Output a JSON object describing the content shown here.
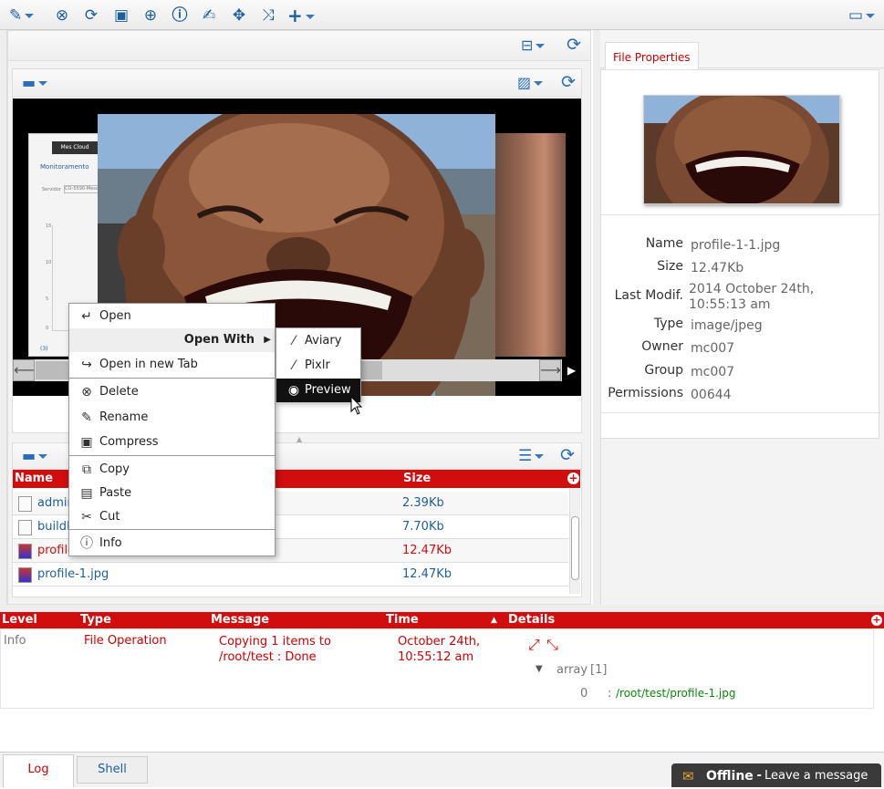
{
  "toolbar": {
    "icons": [
      "edit-icon",
      "cancel-icon",
      "refresh-icon",
      "toolbox-icon",
      "download-icon",
      "info-icon",
      "edit-box-icon",
      "move-icon",
      "shuffle-icon",
      "plus-icon",
      "monitor-icon"
    ]
  },
  "preview": {
    "title": "File Properties",
    "image_caption": "",
    "left_thumb": {
      "tab": "Mes Cloud",
      "heading": "Monitoramento",
      "label": "Servidor",
      "value": "CO-5590-Mesc",
      "y1": "15",
      "y2": "10",
      "y3": "5",
      "x": "0",
      "badge": "(3)"
    }
  },
  "context_menu": {
    "open": "Open",
    "open_with": "Open With",
    "open_new_tab": "Open in new Tab",
    "delete": "Delete",
    "rename": "Rename",
    "compress": "Compress",
    "copy": "Copy",
    "paste": "Paste",
    "cut": "Cut",
    "info": "Info"
  },
  "submenu": {
    "aviary": "Aviary",
    "pixlr": "Pixlr",
    "preview": "Preview"
  },
  "file_list": {
    "col_name": "Name",
    "col_size": "Size",
    "rows": [
      {
        "name": "admin",
        "size": "2.39Kb"
      },
      {
        "name": "buildR",
        "size": "7.70Kb"
      },
      {
        "name": "profile",
        "size": "12.47Kb"
      },
      {
        "name": "profile-1.jpg",
        "size": "12.47Kb"
      }
    ]
  },
  "properties": {
    "tab": "File Properties",
    "rows": [
      {
        "label": "Name",
        "value": "profile-1-1.jpg"
      },
      {
        "label": "Size",
        "value": "12.47Kb"
      },
      {
        "label": "Last Modif.",
        "value": "2014 October 24th, 10:55:13 am"
      },
      {
        "label": "Type",
        "value": "image/jpeg"
      },
      {
        "label": "Owner",
        "value": "mc007"
      },
      {
        "label": "Group",
        "value": "mc007"
      },
      {
        "label": "Permissions",
        "value": "00644"
      }
    ]
  },
  "log": {
    "headers": {
      "level": "Level",
      "type": "Type",
      "message": "Message",
      "time": "Time",
      "details": "Details"
    },
    "row": {
      "level": "Info",
      "type": "File Operation",
      "message": "Copying 1 items to /root/test : Done",
      "time": "October 24th, 10:55:12 am",
      "array_label": "array",
      "array_count": "[1]",
      "index": "0",
      "colon": ":",
      "path": "/root/test/profile-1.jpg"
    }
  },
  "bottom_tabs": {
    "log": "Log",
    "shell": "Shell"
  },
  "chat": {
    "status": "Offline",
    "dash": " - ",
    "message": "Leave a message"
  },
  "colors": {
    "accent_red": "#d10d0d",
    "link_blue": "#1d5f9e"
  }
}
